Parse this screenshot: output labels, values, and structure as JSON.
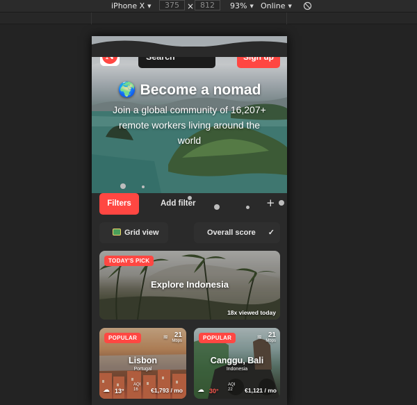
{
  "devtools": {
    "device": "iPhone X",
    "width": "375",
    "times": "×",
    "height": "812",
    "zoom": "93%",
    "network": "Online",
    "caret": "▼",
    "rotate_icon": "rotate-icon"
  },
  "header": {
    "logo_letter": "N",
    "logo_caret": "⌄",
    "search_label": "Search",
    "signup_label": "Sign up"
  },
  "hero": {
    "title": "🌍 Become a nomad",
    "subtitle": "Join a global community of 16,207+ remote workers living around the world"
  },
  "filters": {
    "filters_label": "Filters",
    "add_filter_label": "Add filter",
    "plus": "+"
  },
  "view": {
    "grid_label": "Grid view",
    "sort_label": "Overall score",
    "sort_check": "✓"
  },
  "cards": {
    "featured": {
      "badge": "TODAY'S PICK",
      "title": "Explore Indonesia",
      "viewed": "18x viewed today"
    },
    "lisbon": {
      "badge": "POPULAR",
      "city": "Lisbon",
      "country": "Portugal",
      "wifi_symbol": "≋",
      "speed": "21",
      "speed_unit": "Mbps",
      "weather": "☁",
      "temp": "13°",
      "aqi_label": "AQI",
      "aqi_value": "16",
      "cost": "€1,793 / mo"
    },
    "canggu": {
      "badge": "POPULAR",
      "city": "Canggu, Bali",
      "country": "Indonesia",
      "wifi_symbol": "≋",
      "speed": "21",
      "speed_unit": "Mbps",
      "weather": "☁",
      "temp": "30°",
      "aqi_label": "AQI",
      "aqi_value": "22",
      "cost": "€1,121 / mo"
    }
  },
  "colors": {
    "accent": "#ff4742",
    "background": "#232323",
    "surface": "#2f2f2f"
  }
}
